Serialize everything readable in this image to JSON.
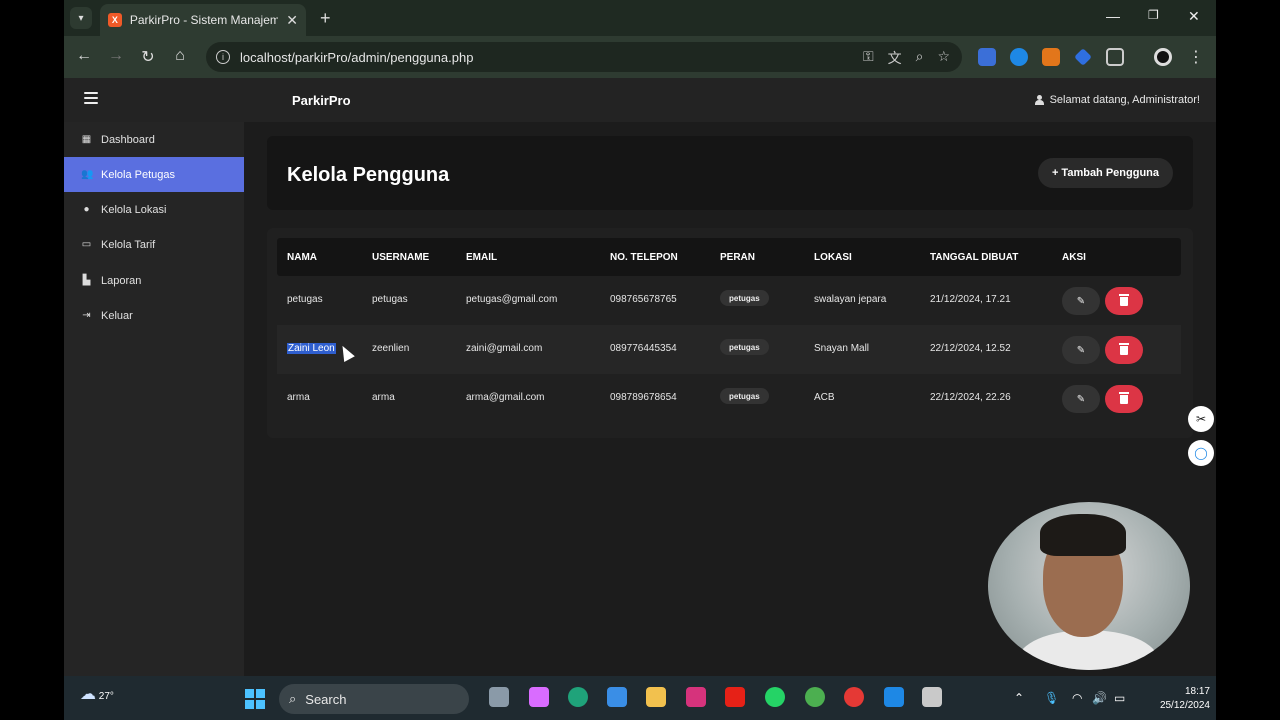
{
  "browser": {
    "tab_title": "ParkirPro - Sistem Manajemen P",
    "url": "localhost/parkirPro/admin/pengguna.php"
  },
  "header": {
    "brand": "ParkirPro",
    "welcome": "Selamat datang, Administrator!"
  },
  "sidebar": {
    "items": [
      {
        "label": "Dashboard",
        "icon": "grid-icon",
        "active": false
      },
      {
        "label": "Kelola Petugas",
        "icon": "users-icon",
        "active": true
      },
      {
        "label": "Kelola Lokasi",
        "icon": "map-pin-icon",
        "active": false
      },
      {
        "label": "Kelola Tarif",
        "icon": "money-icon",
        "active": false
      },
      {
        "label": "Laporan",
        "icon": "chart-icon",
        "active": false
      },
      {
        "label": "Keluar",
        "icon": "logout-icon",
        "active": false
      }
    ]
  },
  "page": {
    "title": "Kelola Pengguna",
    "add_button": "+ Tambah Pengguna"
  },
  "table": {
    "columns": [
      "NAMA",
      "USERNAME",
      "EMAIL",
      "NO. TELEPON",
      "PERAN",
      "LOKASI",
      "TANGGAL DIBUAT",
      "AKSI"
    ],
    "rows": [
      {
        "nama": "petugas",
        "username": "petugas",
        "email": "petugas@gmail.com",
        "telepon": "098765678765",
        "peran": "petugas",
        "lokasi": "swalayan jepara",
        "tanggal": "21/12/2024, 17.21"
      },
      {
        "nama": "Zaini Leon",
        "username": "zeenlien",
        "email": "zaini@gmail.com",
        "telepon": "089776445354",
        "peran": "petugas",
        "lokasi": "Snayan Mall",
        "tanggal": "22/12/2024, 12.52"
      },
      {
        "nama": "arma",
        "username": "arma",
        "email": "arma@gmail.com",
        "telepon": "098789678654",
        "peran": "petugas",
        "lokasi": "ACB",
        "tanggal": "22/12/2024, 22.26"
      }
    ]
  },
  "taskbar": {
    "weather": "27°",
    "search_placeholder": "Search",
    "time": "18:17",
    "date": "25/12/2024"
  },
  "colors": {
    "accent": "#5a6fe0",
    "danger": "#dc3545"
  }
}
